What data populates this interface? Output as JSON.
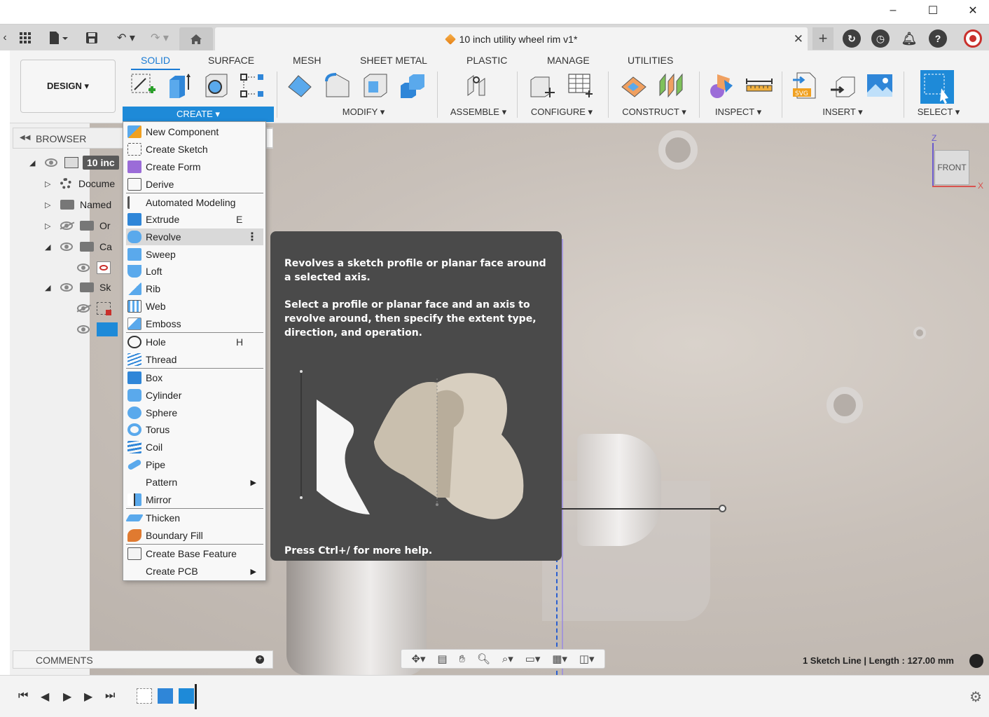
{
  "window": {
    "minimize": "–",
    "maximize": "☐",
    "close": "✕"
  },
  "tabbar": {
    "document_title": "10 inch utility wheel rim v1*",
    "close_glyph": "✕",
    "new_tab_glyph": "+"
  },
  "toolbar": {
    "design_label": "DESIGN ▾",
    "tabs": [
      "SOLID",
      "SURFACE",
      "MESH",
      "SHEET METAL",
      "PLASTIC",
      "MANAGE",
      "UTILITIES"
    ],
    "groups": {
      "create": "CREATE ▾",
      "modify": "MODIFY ▾",
      "assemble": "ASSEMBLE ▾",
      "configure": "CONFIGURE ▾",
      "construct": "CONSTRUCT ▾",
      "inspect": "INSPECT ▾",
      "insert": "INSERT ▾",
      "select": "SELECT ▾"
    }
  },
  "browser": {
    "title": "BROWSER",
    "root_label": "10 inc",
    "rows": [
      "Docume",
      "Named",
      "Or",
      "Ca",
      "Sk"
    ]
  },
  "menu": {
    "items": [
      {
        "label": "New Component",
        "shortcut": ""
      },
      {
        "label": "Create Sketch",
        "shortcut": ""
      },
      {
        "label": "Create Form",
        "shortcut": ""
      },
      {
        "label": "Derive",
        "shortcut": ""
      },
      {
        "label": "Automated Modeling",
        "shortcut": ""
      },
      {
        "label": "Extrude",
        "shortcut": "E"
      },
      {
        "label": "Revolve",
        "shortcut": ""
      },
      {
        "label": "Sweep",
        "shortcut": ""
      },
      {
        "label": "Loft",
        "shortcut": ""
      },
      {
        "label": "Rib",
        "shortcut": ""
      },
      {
        "label": "Web",
        "shortcut": ""
      },
      {
        "label": "Emboss",
        "shortcut": ""
      },
      {
        "label": "Hole",
        "shortcut": "H"
      },
      {
        "label": "Thread",
        "shortcut": ""
      },
      {
        "label": "Box",
        "shortcut": ""
      },
      {
        "label": "Cylinder",
        "shortcut": ""
      },
      {
        "label": "Sphere",
        "shortcut": ""
      },
      {
        "label": "Torus",
        "shortcut": ""
      },
      {
        "label": "Coil",
        "shortcut": ""
      },
      {
        "label": "Pipe",
        "shortcut": ""
      },
      {
        "label": "Pattern",
        "shortcut": ""
      },
      {
        "label": "Mirror",
        "shortcut": ""
      },
      {
        "label": "Thicken",
        "shortcut": ""
      },
      {
        "label": "Boundary Fill",
        "shortcut": ""
      },
      {
        "label": "Create Base Feature",
        "shortcut": ""
      },
      {
        "label": "Create PCB",
        "shortcut": ""
      }
    ],
    "highlighted": "Revolve"
  },
  "tooltip": {
    "line1": "Revolves a sketch profile or planar face around a selected axis.",
    "line2": "Select a profile or planar face and an axis to revolve around, then specify the extent type, direction, and operation.",
    "footer": "Press Ctrl+/ for more help."
  },
  "viewcube": {
    "face": "FRONT",
    "z": "Z",
    "x": "X"
  },
  "comments": {
    "title": "COMMENTS"
  },
  "status": {
    "text": "1 Sketch Line | Length : 127.00 mm"
  },
  "colors": {
    "accent": "#1e8ad8",
    "tooltip_bg": "#4a4a4a",
    "menu_highlight": "#d9d9d9"
  }
}
